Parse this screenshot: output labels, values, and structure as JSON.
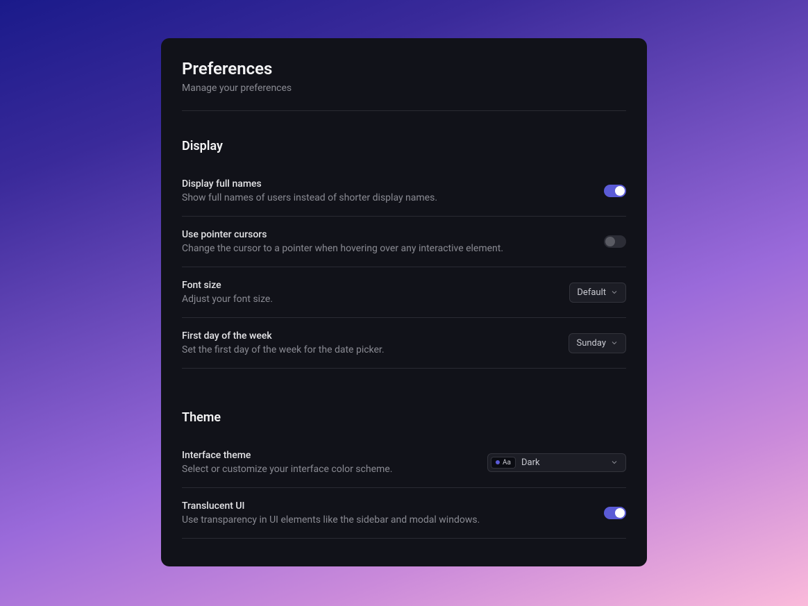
{
  "header": {
    "title": "Preferences",
    "subtitle": "Manage your preferences"
  },
  "sections": {
    "display": {
      "title": "Display",
      "fullNames": {
        "label": "Display full names",
        "desc": "Show full names of users instead of shorter display names.",
        "value": true
      },
      "pointerCursors": {
        "label": "Use pointer cursors",
        "desc": "Change the cursor to a pointer when hovering over any interactive element.",
        "value": false
      },
      "fontSize": {
        "label": "Font size",
        "desc": "Adjust your font size.",
        "value": "Default"
      },
      "firstDay": {
        "label": "First day of the week",
        "desc": "Set the first day of the week for the date picker.",
        "value": "Sunday"
      }
    },
    "theme": {
      "title": "Theme",
      "interfaceTheme": {
        "label": "Interface theme",
        "desc": "Select or customize your interface color scheme.",
        "value": "Dark",
        "swatchText": "Aa"
      },
      "translucent": {
        "label": "Translucent UI",
        "desc": "Use transparency in UI elements like the sidebar and modal windows.",
        "value": true
      }
    }
  }
}
